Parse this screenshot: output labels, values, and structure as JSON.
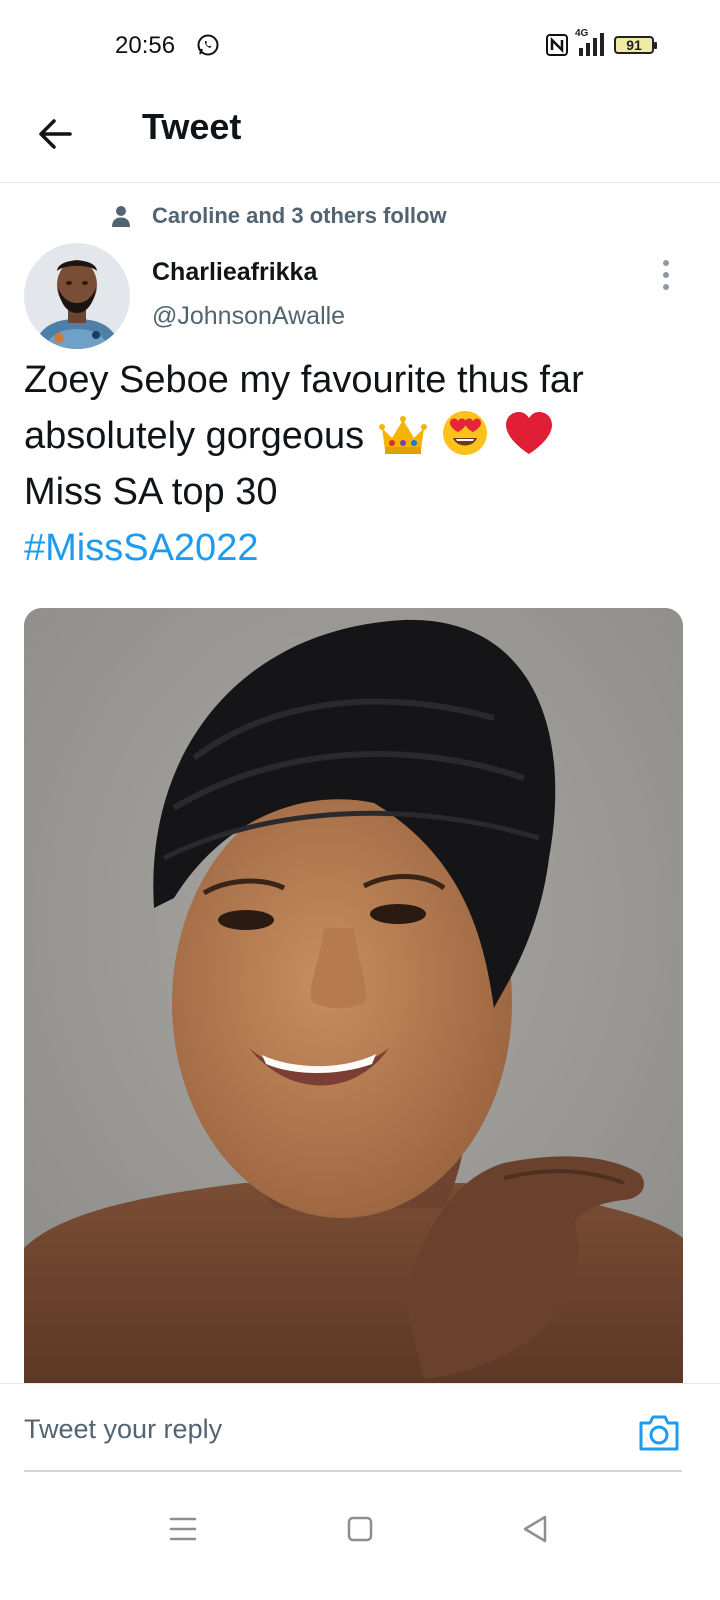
{
  "status_bar": {
    "time": "20:56",
    "network": "4G",
    "battery": "91",
    "icons": [
      "whatsapp-icon",
      "nfc-icon",
      "signal-icon",
      "battery-icon"
    ]
  },
  "header": {
    "title": "Tweet",
    "back_icon": "arrow-left-icon"
  },
  "tweet": {
    "social_context": "Caroline and 3 others follow",
    "author_name": "Charlieafrikka",
    "author_handle": "@JohnsonAwalle",
    "text_line1": "Zoey Seboe my favourite thus far",
    "text_line2": "absolutely gorgeous",
    "text_line3": "Miss SA top 30",
    "hashtag": "#MissSA2022",
    "emojis": [
      "crown-emoji",
      "heart-eyes-emoji",
      "red-heart-emoji"
    ]
  },
  "reply": {
    "placeholder": "Tweet your reply",
    "camera_icon": "camera-icon"
  },
  "nav": [
    "menu-icon",
    "home-square-icon",
    "back-triangle-icon"
  ],
  "colors": {
    "accent": "#1d9bf0",
    "secondary_text": "#536471",
    "primary_text": "#0f1419"
  }
}
